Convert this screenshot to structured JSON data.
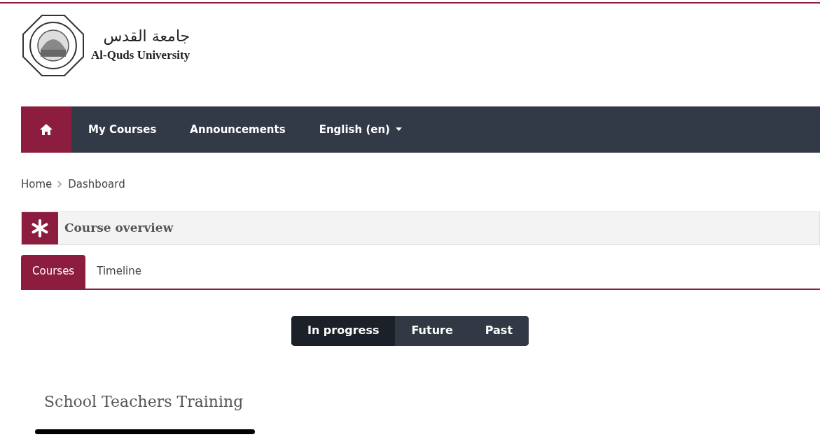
{
  "logo": {
    "arabic_name": "جامعة القدس",
    "english_name": "Al-Quds University"
  },
  "nav": {
    "items": [
      {
        "kind": "home",
        "selected": true
      },
      {
        "kind": "link",
        "label": "My Courses",
        "selected": false
      },
      {
        "kind": "link",
        "label": "Announcements",
        "selected": false
      },
      {
        "kind": "dropdown",
        "label": "English (en)",
        "selected": false
      }
    ]
  },
  "breadcrumb": [
    "Home",
    "Dashboard"
  ],
  "block": {
    "title": "Course overview",
    "tabs": [
      {
        "label": "Courses",
        "selected": true
      },
      {
        "label": "Timeline",
        "selected": false
      }
    ],
    "filters": [
      {
        "label": "In progress",
        "selected": true
      },
      {
        "label": "Future",
        "selected": false
      },
      {
        "label": "Past",
        "selected": false
      }
    ],
    "course_title": "School Teachers Training"
  }
}
